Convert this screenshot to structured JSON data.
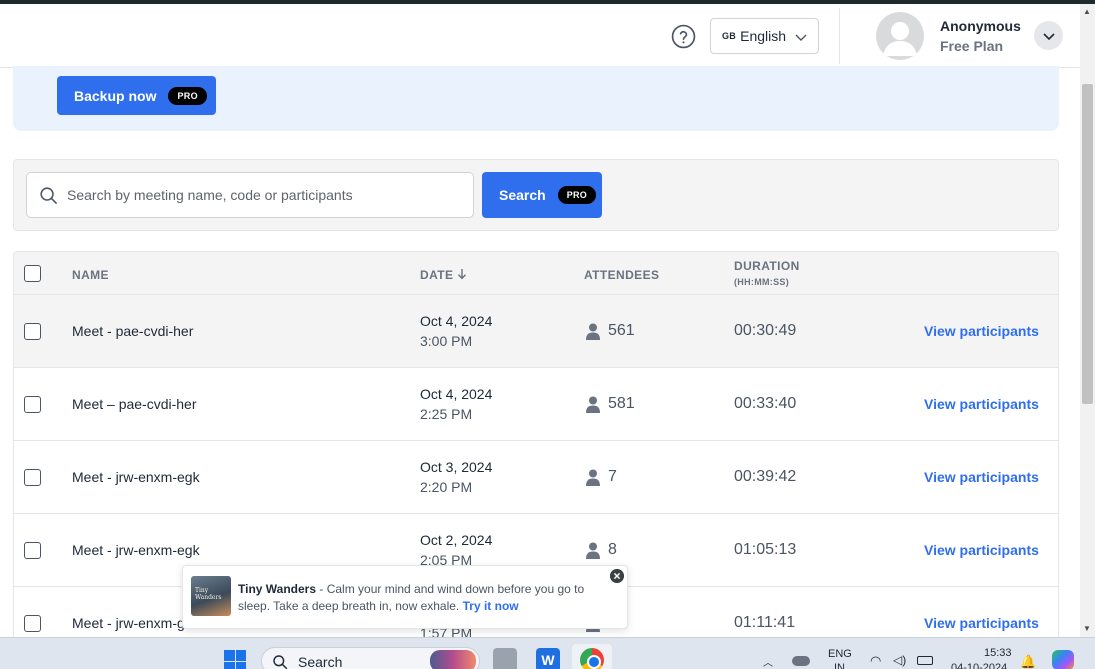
{
  "header": {
    "help_icon": "question-circle-icon",
    "language": {
      "flag": "GB",
      "label": "English"
    },
    "user": {
      "name": "Anonymous",
      "plan": "Free Plan"
    }
  },
  "banner": {
    "backup_label": "Backup now",
    "pro_badge": "PRO"
  },
  "search": {
    "placeholder": "Search by meeting name, code or participants",
    "button_label": "Search",
    "pro_badge": "PRO"
  },
  "table": {
    "columns": {
      "name": "NAME",
      "date": "DATE",
      "attendees": "ATTENDEES",
      "duration": "DURATION",
      "duration_unit": "(HH:MM:SS)"
    },
    "sort_icon": "arrow-down-icon",
    "rows": [
      {
        "name": "Meet - pae-cvdi-her",
        "date": "Oct 4, 2024",
        "time": "3:00 PM",
        "attendees": "561",
        "duration": "00:30:49",
        "action": "View participants"
      },
      {
        "name": "Meet – pae-cvdi-her",
        "date": "Oct 4, 2024",
        "time": "2:25 PM",
        "attendees": "581",
        "duration": "00:33:40",
        "action": "View participants"
      },
      {
        "name": "Meet - jrw-enxm-egk",
        "date": "Oct 3, 2024",
        "time": "2:20 PM",
        "attendees": "7",
        "duration": "00:39:42",
        "action": "View participants"
      },
      {
        "name": "Meet - jrw-enxm-egk",
        "date": "Oct 2, 2024",
        "time": "2:05 PM",
        "attendees": "8",
        "duration": "01:05:13",
        "action": "View participants"
      },
      {
        "name": "Meet - jrw-enxm-g",
        "date": "",
        "time": "1:57 PM",
        "attendees": "",
        "duration": "01:11:41",
        "action": "View participants"
      }
    ]
  },
  "toast": {
    "image_text": "Tiny Wanders",
    "title": "Tiny Wanders",
    "message": " - Calm your mind and wind down before you go to sleep. Take a deep breath in, now exhale. ",
    "link": "Try it now",
    "close_icon": "close-circle-icon"
  },
  "taskbar": {
    "search_label": "Search",
    "tray": {
      "lang_line1": "ENG",
      "lang_line2": "IN",
      "time": "15:33",
      "date": "04-10-2024"
    }
  },
  "colors": {
    "accent": "#2f6fee",
    "banner_bg": "#eaf2fd",
    "row_highlight": "#f4f4f5"
  }
}
